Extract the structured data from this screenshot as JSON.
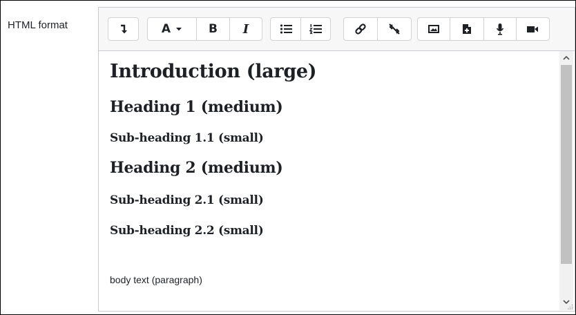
{
  "form": {
    "label": "HTML format"
  },
  "editor": {
    "content": {
      "intro": "Introduction (large)",
      "heading1": "Heading 1 (medium)",
      "subheading11": "Sub-heading 1.1 (small)",
      "heading2": "Heading 2 (medium)",
      "subheading21": "Sub-heading 2.1 (small)",
      "subheading22": "Sub-heading 2.2 (small)",
      "body": "body text (paragraph)"
    },
    "toolbar": {
      "font_size_letter": "A",
      "bold_letter": "B",
      "italic_letter": "I"
    }
  }
}
